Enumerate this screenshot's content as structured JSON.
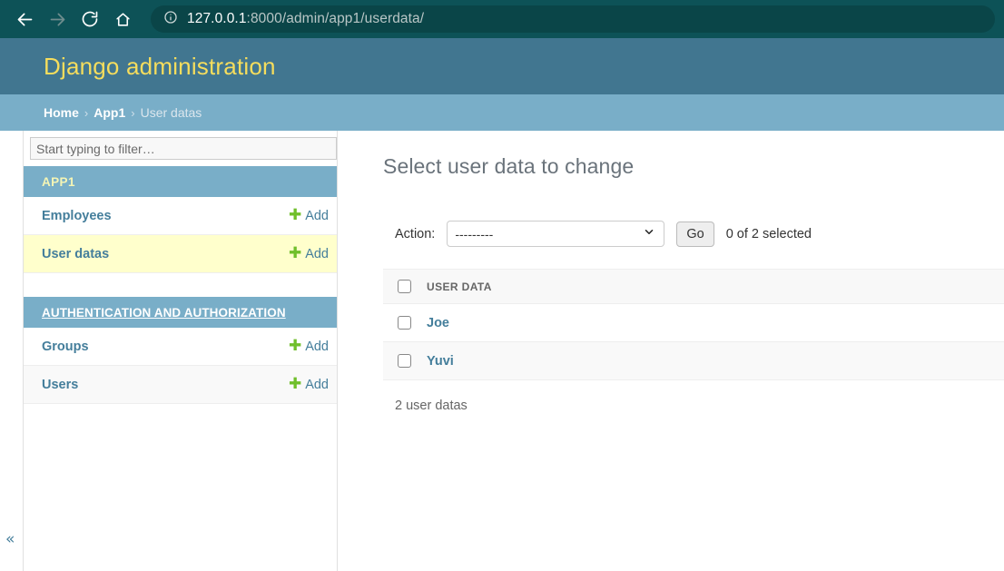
{
  "browser": {
    "back_icon": "arrow-left-icon",
    "forward_icon": "arrow-right-icon",
    "reload_icon": "reload-icon",
    "home_icon": "home-icon",
    "info_icon": "page-info-icon",
    "url_host": "127.0.0.1",
    "url_path": ":8000/admin/app1/userdata/"
  },
  "header": {
    "title": "Django administration"
  },
  "breadcrumbs": {
    "home": "Home",
    "sep": "›",
    "app": "App1",
    "current": "User datas"
  },
  "sidebar": {
    "filter_placeholder": "Start typing to filter…",
    "filter_value": "",
    "collapse_label": "«",
    "modules": [
      {
        "caption": "APP1",
        "is_link": false,
        "models": [
          {
            "name": "Employees",
            "add_label": "Add",
            "current": false
          },
          {
            "name": "User datas",
            "add_label": "Add",
            "current": true
          }
        ]
      },
      {
        "caption": "AUTHENTICATION AND AUTHORIZATION",
        "is_link": true,
        "models": [
          {
            "name": "Groups",
            "add_label": "Add",
            "current": false
          },
          {
            "name": "Users",
            "add_label": "Add",
            "current": false
          }
        ]
      }
    ]
  },
  "content": {
    "title": "Select user data to change",
    "actions": {
      "label": "Action:",
      "selected_option": "---------",
      "options": [
        "---------"
      ],
      "go_label": "Go",
      "counter": "0 of 2 selected"
    },
    "table": {
      "columns": [
        "USER DATA"
      ],
      "rows": [
        {
          "user_data": "Joe"
        },
        {
          "user_data": "Yuvi"
        }
      ]
    },
    "paginator": "2 user datas"
  },
  "colors": {
    "browser_bg": "#0d5257",
    "url_pill_bg": "#0a4548",
    "django_header": "#417690",
    "django_title": "#f5dd5d",
    "breadcrumb_bg": "#79aec8",
    "link": "#447e9b",
    "plus_green": "#70bf2b",
    "current_row": "#ffffcc"
  }
}
